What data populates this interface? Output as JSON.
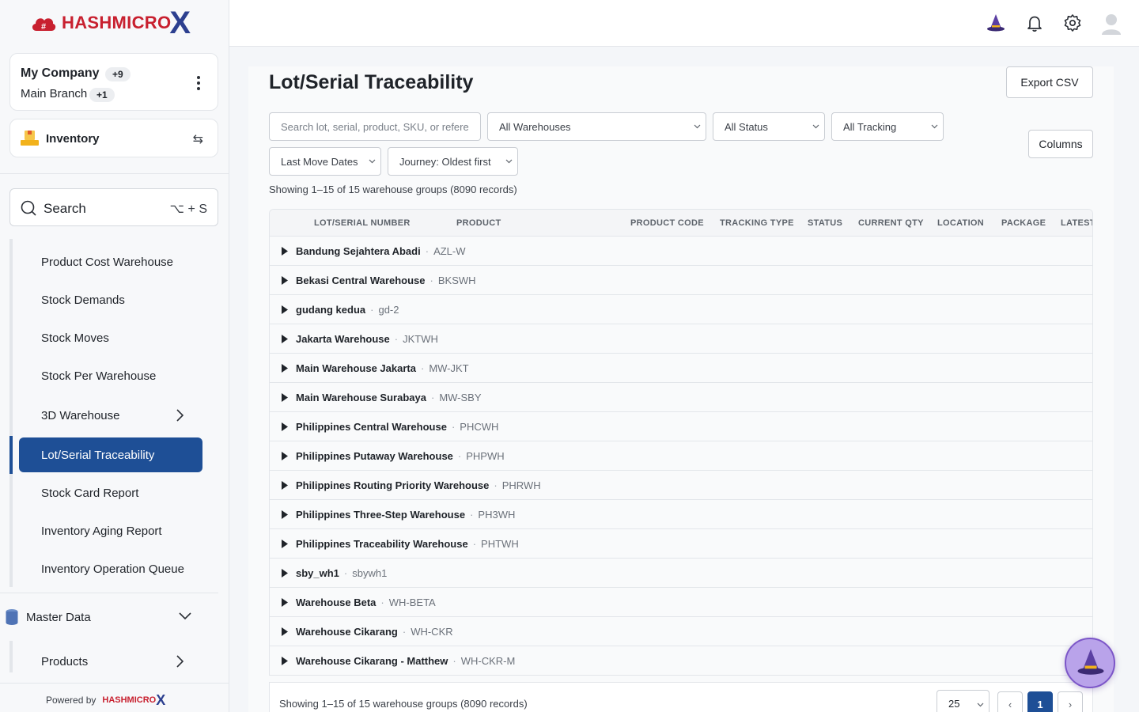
{
  "brand": {
    "name": "HASHMICRO",
    "x": "X"
  },
  "company": {
    "name": "My Company",
    "company_badge": "+9",
    "branch": "Main Branch",
    "branch_badge": "+1"
  },
  "module": {
    "label": "Inventory"
  },
  "search": {
    "label": "Search",
    "shortcut": "⌥ + S"
  },
  "menu": {
    "items": [
      "Product Cost Warehouse",
      "Stock Demands",
      "Stock Moves",
      "Stock Per Warehouse",
      "3D Warehouse",
      "Lot/Serial Traceability",
      "Stock Card Report",
      "Inventory Aging Report",
      "Inventory Operation Queue"
    ],
    "master_data": "Master Data",
    "products": "Products",
    "powered_by": "Powered by"
  },
  "page": {
    "title": "Lot/Serial Traceability",
    "export_label": "Export CSV",
    "columns_label": "Columns",
    "search_placeholder": "Search lot, serial, product, SKU, or refere",
    "filter_warehouse": "All Warehouses",
    "filter_status": "All Status",
    "filter_tracking": "All Tracking",
    "filter_dates": "Last Move Dates",
    "filter_journey": "Journey: Oldest first",
    "showing": "Showing 1–15 of 15 warehouse groups (8090 records)"
  },
  "table": {
    "headers": [
      "LOT/SERIAL NUMBER",
      "PRODUCT",
      "PRODUCT CODE",
      "TRACKING TYPE",
      "STATUS",
      "CURRENT QTY",
      "LOCATION",
      "PACKAGE",
      "LATEST"
    ],
    "rows": [
      {
        "name": "Bandung Sejahtera Abadi",
        "code": "AZL-W"
      },
      {
        "name": "Bekasi Central Warehouse",
        "code": "BKSWH"
      },
      {
        "name": "gudang kedua",
        "code": "gd-2"
      },
      {
        "name": "Jakarta Warehouse",
        "code": "JKTWH"
      },
      {
        "name": "Main Warehouse Jakarta",
        "code": "MW-JKT"
      },
      {
        "name": "Main Warehouse Surabaya",
        "code": "MW-SBY"
      },
      {
        "name": "Philippines Central Warehouse",
        "code": "PHCWH"
      },
      {
        "name": "Philippines Putaway Warehouse",
        "code": "PHPWH"
      },
      {
        "name": "Philippines Routing Priority Warehouse",
        "code": "PHRWH"
      },
      {
        "name": "Philippines Three-Step Warehouse",
        "code": "PH3WH"
      },
      {
        "name": "Philippines Traceability Warehouse",
        "code": "PHTWH"
      },
      {
        "name": "sby_wh1",
        "code": "sbywh1"
      },
      {
        "name": "Warehouse Beta",
        "code": "WH-BETA"
      },
      {
        "name": "Warehouse Cikarang",
        "code": "WH-CKR"
      },
      {
        "name": "Warehouse Cikarang - Matthew",
        "code": "WH-CKR-M"
      }
    ],
    "separator": "·"
  },
  "pagination": {
    "footer_text": "Showing 1–15 of 15 warehouse groups (8090 records)",
    "page_size": "25",
    "prev": "‹",
    "current": "1",
    "next": "›"
  },
  "colors": {
    "accent": "#1e4f96",
    "brand_red": "#c8202f",
    "brand_navy": "#2c3f8f"
  }
}
